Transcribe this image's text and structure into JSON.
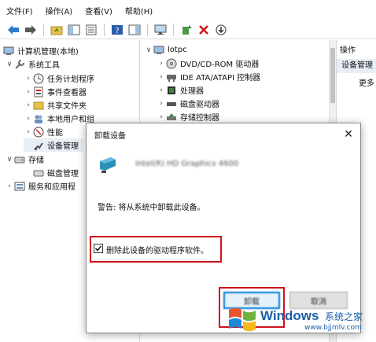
{
  "menubar": {
    "items": [
      "文件(F)",
      "操作(A)",
      "查看(V)",
      "帮助(H)"
    ]
  },
  "toolbar": {
    "icons": [
      "back-arrow-icon",
      "forward-arrow-icon",
      "up-folder-icon",
      "console-tree-icon",
      "properties-icon",
      "help-icon",
      "help-pane-icon",
      "monitor-icon",
      "update-driver-icon",
      "uninstall-x-icon",
      "download-icon"
    ]
  },
  "left_tree": {
    "root": "计算机管理(本地)",
    "system_tools": "系统工具",
    "task_scheduler": "任务计划程序",
    "event_viewer": "事件查看器",
    "shared_folders": "共享文件夹",
    "local_users": "本地用户和组",
    "performance": "性能",
    "device_manager": "设备管理",
    "storage": "存储",
    "disk_management": "磁盘管理",
    "services_apps": "服务和应用程"
  },
  "device_tree": {
    "computer": "lotpc",
    "items": [
      "DVD/CD-ROM 驱动器",
      "IDE ATA/ATAPI 控制器",
      "处理器",
      "磁盘驱动器",
      "存储控制器"
    ]
  },
  "actions": {
    "header": "操作",
    "selected": "设备管理",
    "more": "更多"
  },
  "dialog": {
    "title": "卸载设备",
    "close": "✕",
    "device_name": "Intel(R) HD Graphics 4600",
    "warning": "警告: 将从系统中卸载此设备。",
    "checkbox_label": "删除此设备的驱动程序软件。",
    "checkbox_checked": true,
    "ok_label": "卸载",
    "cancel_label": "取消"
  },
  "watermark": {
    "brand": "Windows",
    "cn": "系统之家",
    "url": "www.bjjmlv.com"
  },
  "colors": {
    "highlight_red": "#d0131a",
    "accent_blue": "#0078d7",
    "selection_bg": "#e8eef6",
    "watermark_blue": "#1a5fa8"
  }
}
